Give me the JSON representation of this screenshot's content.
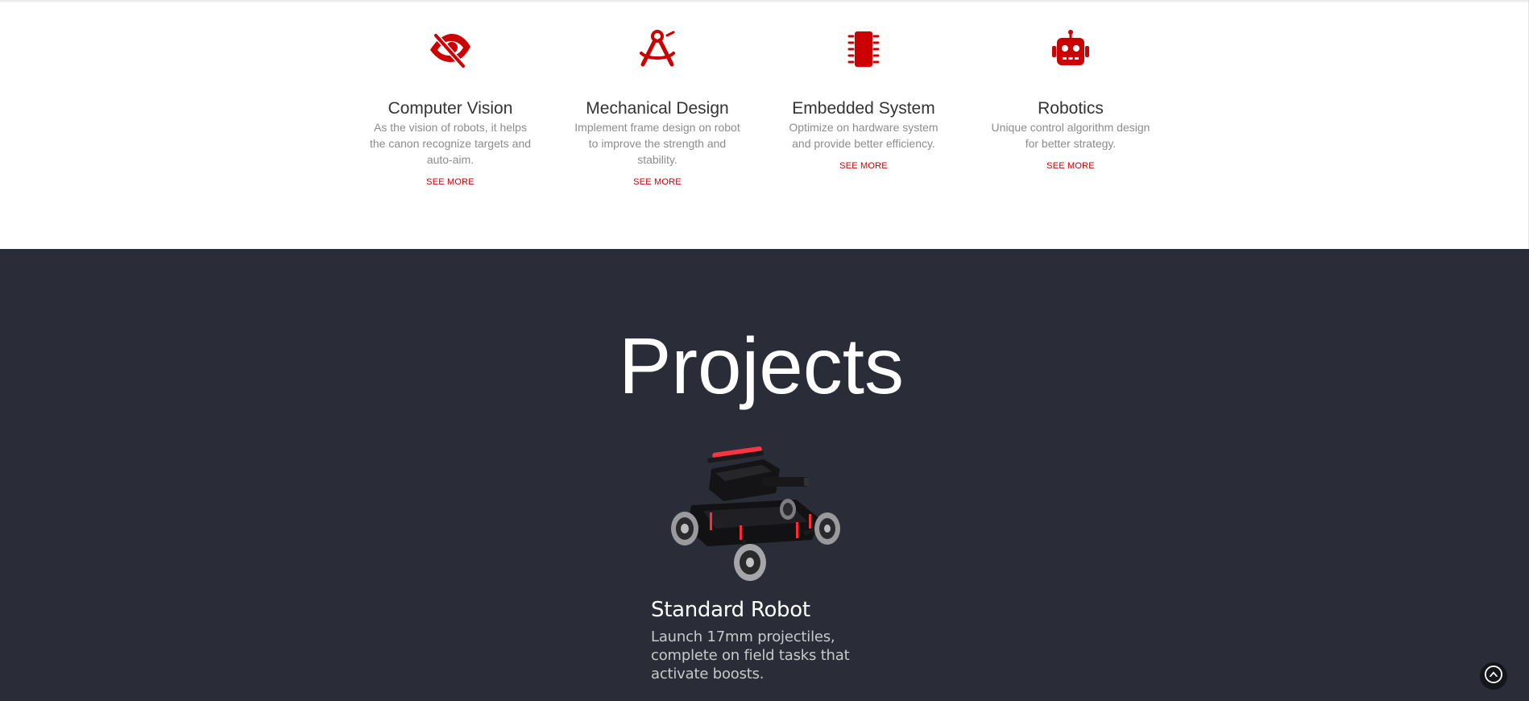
{
  "colors": {
    "accent": "#cc0000",
    "dark_section": "#2a2d38",
    "title_text": "#333333",
    "desc_text": "#8c8c8c"
  },
  "services": [
    {
      "icon": "eye-slash-icon",
      "title": "Computer Vision",
      "description": "As the vision of robots, it helps the canon recognize targets and auto-aim.",
      "link": "SEE MORE"
    },
    {
      "icon": "compass-drafting-icon",
      "title": "Mechanical Design",
      "description": "Implement frame design on robot to improve the strength and stability.",
      "link": "SEE MORE"
    },
    {
      "icon": "microchip-icon",
      "title": "Embedded System",
      "description": "Optimize on hardware system and provide better efficiency.",
      "link": "SEE MORE"
    },
    {
      "icon": "robot-icon",
      "title": "Robotics",
      "description": "Unique control algorithm design for better strategy.",
      "link": "SEE MORE"
    }
  ],
  "projects": {
    "heading": "Projects",
    "items": [
      {
        "image": "standard-robot-image",
        "title": "Standard Robot",
        "description": "Launch 17mm projectiles, complete on field tasks that activate boosts."
      }
    ]
  },
  "back_to_top_icon": "chevron-up-circle-icon"
}
